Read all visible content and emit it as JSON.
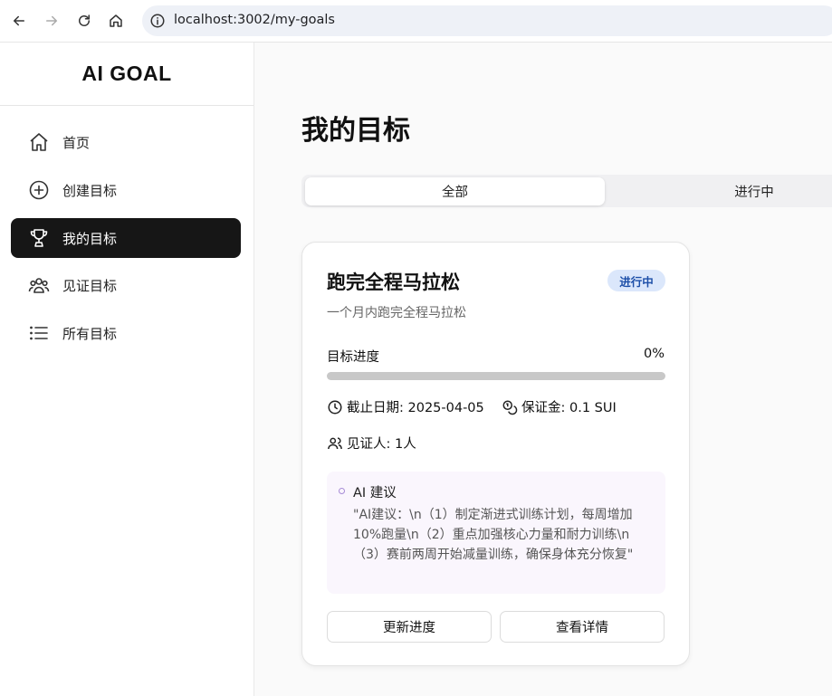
{
  "browser": {
    "url": "localhost:3002/my-goals",
    "icons": [
      "back-arrow-icon",
      "forward-arrow-icon",
      "reload-icon",
      "home-icon",
      "site-info-icon"
    ]
  },
  "sidebar": {
    "brand": "AI GOAL",
    "items": [
      {
        "label": "首页",
        "icon": "home-icon"
      },
      {
        "label": "创建目标",
        "icon": "plus-circle-icon"
      },
      {
        "label": "我的目标",
        "icon": "trophy-icon",
        "active": true
      },
      {
        "label": "见证目标",
        "icon": "users-icon"
      },
      {
        "label": "所有目标",
        "icon": "list-icon"
      }
    ]
  },
  "main": {
    "title": "我的目标",
    "tabs": [
      {
        "label": "全部",
        "active": true
      },
      {
        "label": "进行中"
      }
    ]
  },
  "card": {
    "title": "跑完全程马拉松",
    "status": "进行中",
    "description": "一个月内跑完全程马拉松",
    "progress_label": "目标进度",
    "progress_text": "0%",
    "progress": 0,
    "deadline": "截止日期: 2025-04-05",
    "deposit": "保证金: 0.1 SUI",
    "witness": "见证人: 1人",
    "ai_title": "AI 建议",
    "ai_text": "\"AI建议：\\n（1）制定渐进式训练计划，每周增加10%跑量\\n（2）重点加强核心力量和耐力训练\\n（3）赛前两周开始减量训练，确保身体充分恢复\"",
    "update_button": "更新进度",
    "detail_button": "查看详情"
  },
  "colors": {
    "active_nav": "#161616",
    "badge_bg": "#dbe7fb",
    "badge_text": "#1d4fa8",
    "progress_track": "#c8c8c8",
    "ai_box_bg": "#faf6fd"
  }
}
